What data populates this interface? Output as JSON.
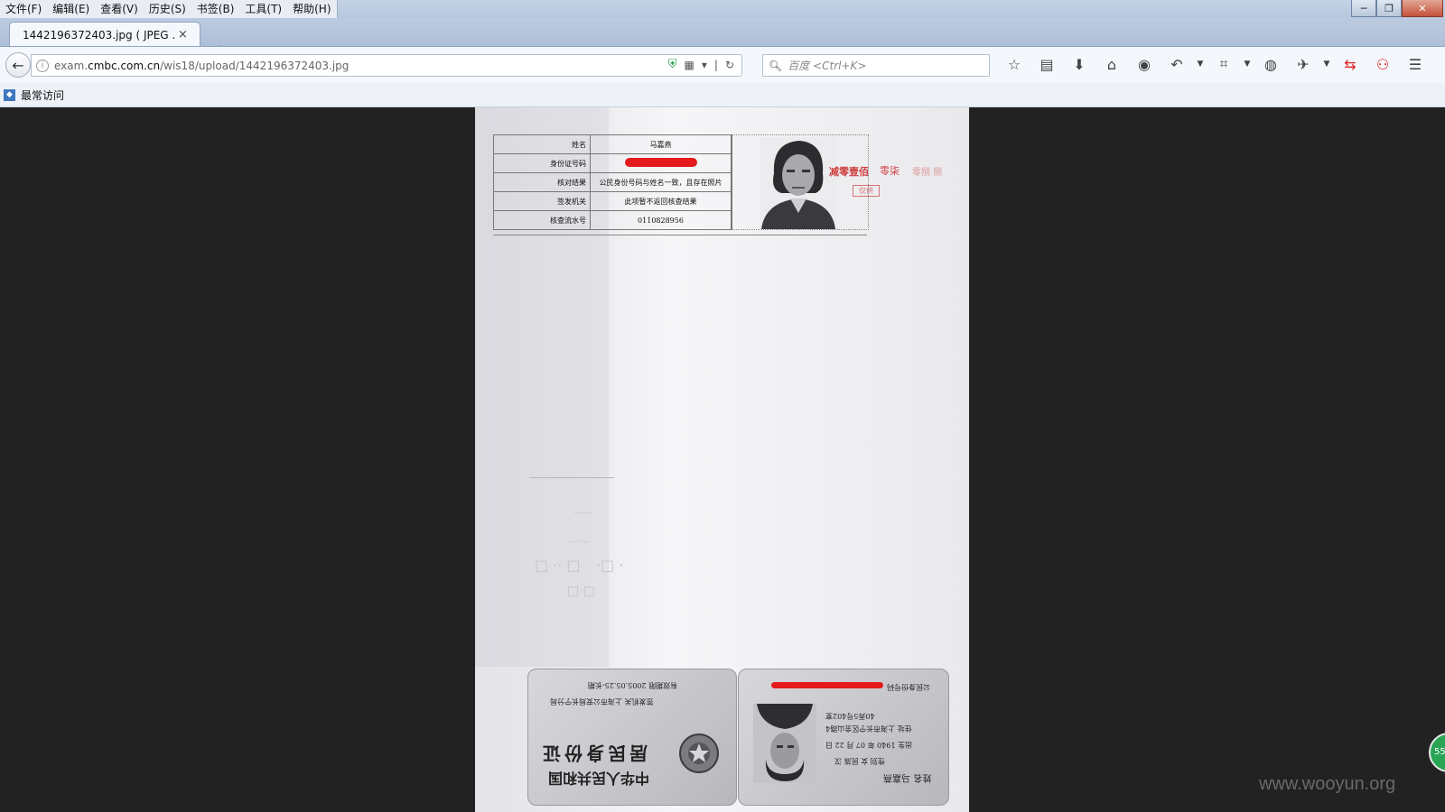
{
  "menu": [
    "文件(F)",
    "编辑(E)",
    "查看(V)",
    "历史(S)",
    "书签(B)",
    "工具(T)",
    "帮助(H)"
  ],
  "window_controls": {
    "minimize": "─",
    "restore": "❐",
    "close": "✕"
  },
  "tab": {
    "title": "1442196372403.jpg ( JPEG ...",
    "close": "×",
    "new_tab": "+"
  },
  "nav": {
    "back": "←",
    "url_prefix": "exam.",
    "url_domain": "cmbc.com.cn",
    "url_path": "/wis18/upload/1442196372403.jpg",
    "search_placeholder": "百度 <Ctrl+K>"
  },
  "toolbar_icons": [
    "bookmark-star-icon",
    "reading-list-icon",
    "download-icon",
    "home-icon",
    "chat-icon",
    "undo-icon",
    "dropdown-icon",
    "crop-icon",
    "dropdown-icon",
    "comment-icon",
    "extension-icon",
    "dropdown-icon",
    "sync-icon",
    "security-icon",
    "menu-icon"
  ],
  "bookmarks": {
    "item": "最常访问"
  },
  "document": {
    "table": [
      {
        "key": "姓名",
        "value": "马嘉燕"
      },
      {
        "key": "身份证号码",
        "value": ""
      },
      {
        "key": "核对结果",
        "value": "公民身份号码与姓名一致，且存在照片"
      },
      {
        "key": "签发机关",
        "value": "此项暂不返回核查结果"
      },
      {
        "key": "核查流水号",
        "value": "0110828956"
      }
    ],
    "stamps": [
      "减零壹佰",
      "零柒",
      "零捌 捌",
      "仅供"
    ],
    "faint_marks": [
      "——",
      "—·—",
      "□ ·· □",
      "·□ ·",
      "□·□"
    ],
    "card_back": {
      "title": "中华人民共和国",
      "subtitle": "居民身份证",
      "authority": "签发机关 上海市公安局长宁分局",
      "validity": "有效期限 2005.05.25-长期"
    },
    "card_front": {
      "name_row": "姓名 马嘉燕",
      "gender_row": "性别 女 民族 汉",
      "birth_row": "出生 1940 年 07 月 22 日",
      "address_row": "住址 上海市长宁区金山路4",
      "address_row2": "40弄5号402室",
      "id_row": "公民身份号码"
    }
  },
  "watermark": "www.wooyun.org",
  "badge": "55",
  "colors": {
    "redaction": "#e41a1c",
    "stamp": "#d04040",
    "viewer_bg": "#222222"
  }
}
